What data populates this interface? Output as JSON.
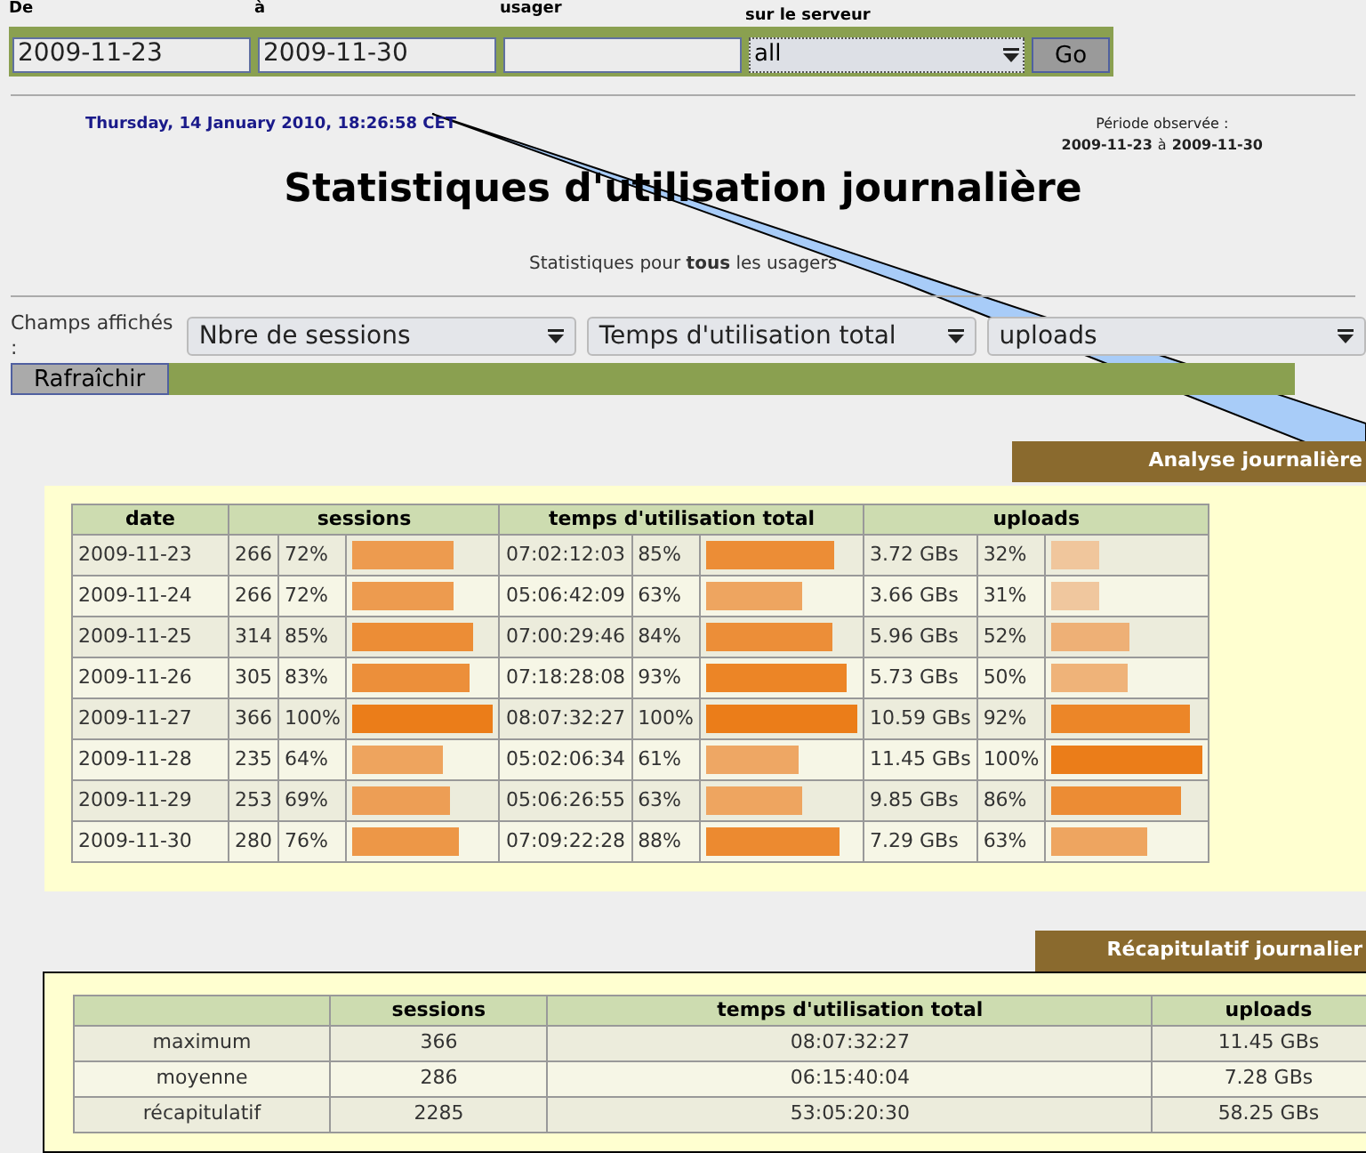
{
  "form": {
    "fields": [
      {
        "label": "De",
        "value": "2009-11-23",
        "kind": "text"
      },
      {
        "label": "à",
        "value": "2009-11-30",
        "kind": "text"
      },
      {
        "label": "usager",
        "kind": "text"
      },
      {
        "label": "sur le serveur",
        "value": "all",
        "kind": "select"
      }
    ],
    "submit": "Go"
  },
  "timestamp": "Thursday, 14 January 2010, 18:26:58 CET",
  "period": {
    "label": "Période observée :",
    "start": "2009-11-23",
    "connector": "à",
    "end": "2009-11-30"
  },
  "title": "Statistiques d'utilisation journalière",
  "subtitle": "Statistiques pour **tous** les usagers",
  "fields_selector": {
    "label": "Champs affichés :",
    "selects": [
      "Nbre de sessions",
      "Temps d'utilisation total",
      "uploads"
    ],
    "refresh": "Rafraîchir"
  },
  "analysis": {
    "title": "Analyse journalière",
    "columns": [
      "date",
      "sessions",
      "temps d'utilisation total",
      "uploads"
    ],
    "rows": [
      {
        "date": "2009-11-23",
        "sessions": {
          "value": "266",
          "percent": "72%",
          "level": 0.72
        },
        "time": {
          "value": "07:02:12:03",
          "percent": "85%",
          "level": 0.85
        },
        "uploads": {
          "value": "3.72 GBs",
          "percent": "32%",
          "level": 0.32
        }
      },
      {
        "date": "2009-11-24",
        "sessions": {
          "value": "266",
          "percent": "72%",
          "level": 0.72
        },
        "time": {
          "value": "05:06:42:09",
          "percent": "63%",
          "level": 0.63
        },
        "uploads": {
          "value": "3.66 GBs",
          "percent": "31%",
          "level": 0.31
        }
      },
      {
        "date": "2009-11-25",
        "sessions": {
          "value": "314",
          "percent": "85%",
          "level": 0.85
        },
        "time": {
          "value": "07:00:29:46",
          "percent": "84%",
          "level": 0.84
        },
        "uploads": {
          "value": "5.96 GBs",
          "percent": "52%",
          "level": 0.52
        }
      },
      {
        "date": "2009-11-26",
        "sessions": {
          "value": "305",
          "percent": "83%",
          "level": 0.83
        },
        "time": {
          "value": "07:18:28:08",
          "percent": "93%",
          "level": 0.93
        },
        "uploads": {
          "value": "5.73 GBs",
          "percent": "50%",
          "level": 0.5
        }
      },
      {
        "date": "2009-11-27",
        "sessions": {
          "value": "366",
          "percent": "100%",
          "level": 1
        },
        "time": {
          "value": "08:07:32:27",
          "percent": "100%",
          "level": 1
        },
        "uploads": {
          "value": "10.59 GBs",
          "percent": "92%",
          "level": 0.92
        }
      },
      {
        "date": "2009-11-28",
        "sessions": {
          "value": "235",
          "percent": "64%",
          "level": 0.64
        },
        "time": {
          "value": "05:02:06:34",
          "percent": "61%",
          "level": 0.61
        },
        "uploads": {
          "value": "11.45 GBs",
          "percent": "100%",
          "level": 1
        }
      },
      {
        "date": "2009-11-29",
        "sessions": {
          "value": "253",
          "percent": "69%",
          "level": 0.69
        },
        "time": {
          "value": "05:06:26:55",
          "percent": "63%",
          "level": 0.63
        },
        "uploads": {
          "value": "9.85 GBs",
          "percent": "86%",
          "level": 0.86
        }
      },
      {
        "date": "2009-11-30",
        "sessions": {
          "value": "280",
          "percent": "76%",
          "level": 0.76
        },
        "time": {
          "value": "07:09:22:28",
          "percent": "88%",
          "level": 0.88
        },
        "uploads": {
          "value": "7.29 GBs",
          "percent": "63%",
          "level": 0.63
        }
      }
    ]
  },
  "summary": {
    "title": "Récapitulatif journalier",
    "columns": [
      "sessions",
      "temps d'utilisation total",
      "uploads"
    ],
    "rows": [
      {
        "label": "maximum",
        "sessions": "366",
        "time": "08:07:32:27",
        "uploads": "11.45 GBs"
      },
      {
        "label": "moyenne",
        "sessions": "286",
        "time": "06:15:40:04",
        "uploads": "7.28 GBs"
      },
      {
        "label": "récapitulatif",
        "sessions": "2285",
        "time": "53:05:20:30",
        "uploads": "58.25 GBs"
      }
    ]
  }
}
